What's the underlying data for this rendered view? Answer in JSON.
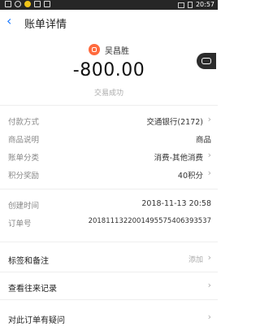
{
  "status_bar": {
    "time": "20:57"
  },
  "header": {
    "back_icon": "chevron-left-icon",
    "title": "账单详情"
  },
  "payee": {
    "name": "吴昌胜",
    "avatar_color": "#ff6a3d"
  },
  "amount": "-800.00",
  "tx_status": "交易成功",
  "details": [
    {
      "label": "付款方式",
      "value": "交通银行(2172)",
      "arrow": true
    },
    {
      "label": "商品说明",
      "value": "商品",
      "arrow": false
    },
    {
      "label": "账单分类",
      "value": "消费-其他消费",
      "arrow": true
    },
    {
      "label": "积分奖励",
      "value": "40积分",
      "arrow": true
    }
  ],
  "meta": [
    {
      "label": "创建时间",
      "value": "2018-11-13 20:58"
    },
    {
      "label": "订单号",
      "value": "20181113220014955754063935​37"
    }
  ],
  "actions": [
    {
      "label": "标签和备注",
      "value": "添加"
    },
    {
      "label": "查看往来记录",
      "value": ""
    },
    {
      "label": "对此订单有疑问",
      "value": ""
    }
  ],
  "colors": {
    "accent": "#1677ff",
    "status_bar": "#262626"
  }
}
